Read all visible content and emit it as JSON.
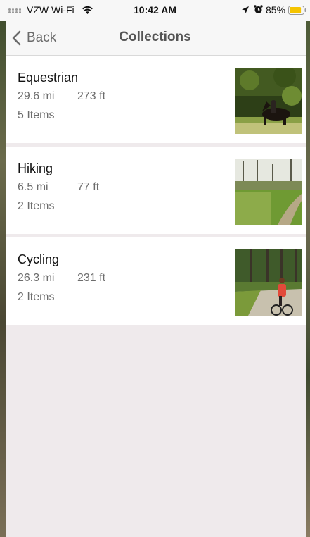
{
  "status": {
    "carrier": "VZW Wi-Fi",
    "time": "10:42 AM",
    "battery": "85%",
    "battery_color": "#f5c400"
  },
  "nav": {
    "back_label": "Back",
    "title": "Collections"
  },
  "collections": [
    {
      "title": "Equestrian",
      "distance": "29.6 mi",
      "elevation": "273 ft",
      "count": "5 Items",
      "image": "horse-rider-photo"
    },
    {
      "title": "Hiking",
      "distance": "6.5 mi",
      "elevation": "77 ft",
      "count": "2 Items",
      "image": "trail-meadow-photo"
    },
    {
      "title": "Cycling",
      "distance": "26.3 mi",
      "elevation": "231 ft",
      "count": "2 Items",
      "image": "cyclist-road-photo"
    }
  ]
}
